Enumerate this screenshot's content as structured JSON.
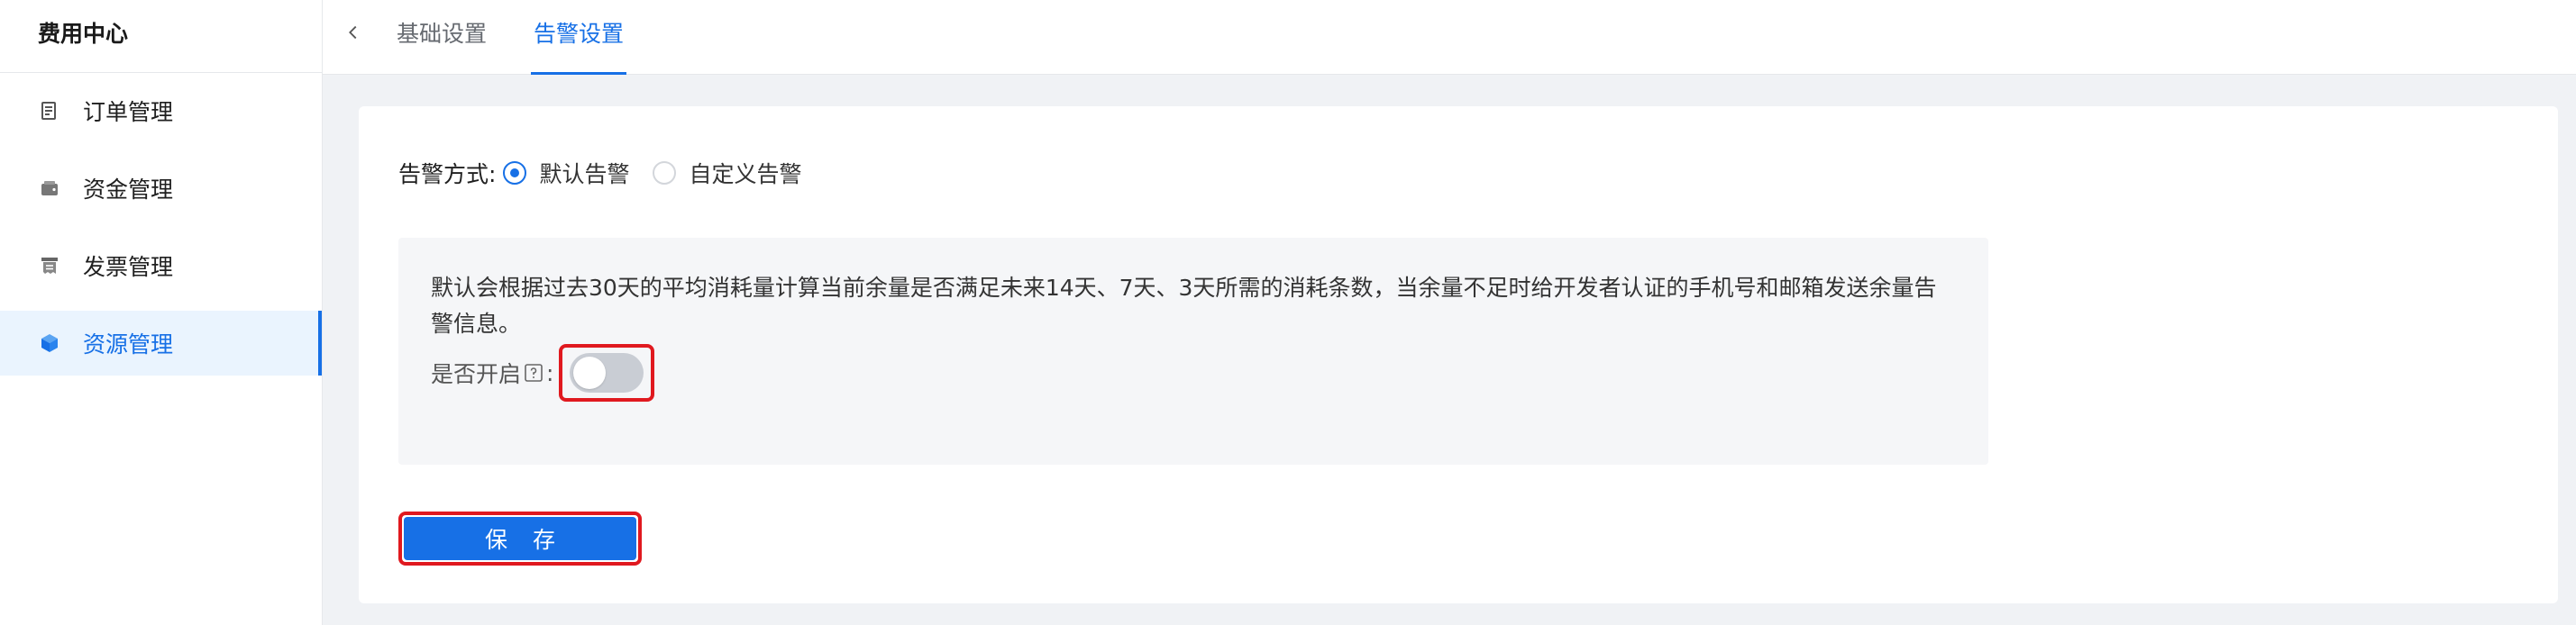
{
  "sidebar": {
    "title": "费用中心",
    "items": [
      {
        "label": "订单管理",
        "icon": "order-icon",
        "active": false
      },
      {
        "label": "资金管理",
        "icon": "wallet-icon",
        "active": false
      },
      {
        "label": "发票管理",
        "icon": "invoice-icon",
        "active": false
      },
      {
        "label": "资源管理",
        "icon": "cube-icon",
        "active": true
      }
    ]
  },
  "topbar": {
    "back_icon": "chevron-left-icon",
    "tabs": [
      {
        "label": "基础设置",
        "active": false
      },
      {
        "label": "告警设置",
        "active": true
      }
    ]
  },
  "alert": {
    "method_label": "告警方式:",
    "options": [
      {
        "label": "默认告警",
        "checked": true
      },
      {
        "label": "自定义告警",
        "checked": false
      }
    ],
    "description": "默认会根据过去30天的平均消耗量计算当前余量是否满足未来14天、7天、3天所需的消耗条数，当余量不足时给开发者认证的手机号和邮箱发送余量告警信息。",
    "enable_label": "是否开启",
    "enable_suffix": ":",
    "enabled": false,
    "save_label": "保 存"
  },
  "colors": {
    "accent": "#1770e6",
    "highlight_border": "#e0191f",
    "switch_off": "#c9cdd4"
  }
}
